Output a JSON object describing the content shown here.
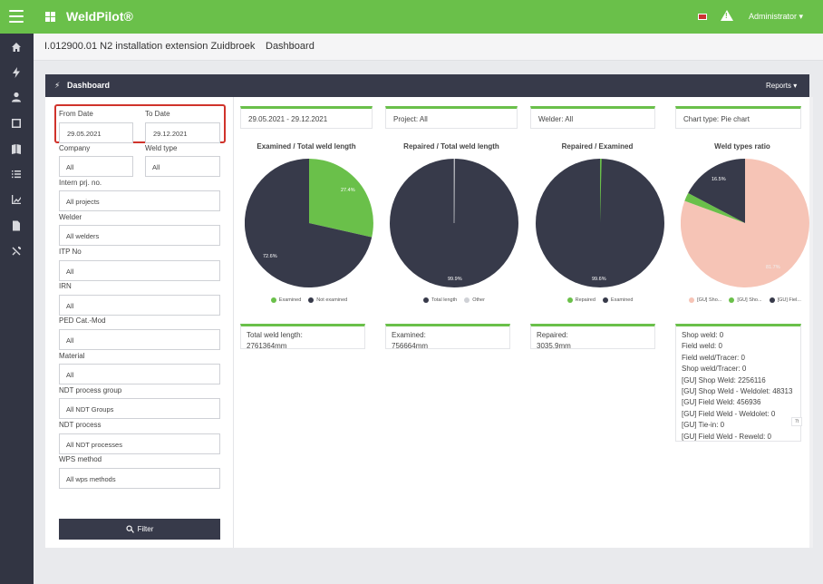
{
  "app": {
    "brand": "WeldPilot®",
    "user": "Administrator ▾"
  },
  "breadcrumb": {
    "project": "I.012900.01 N2 installation extension Zuidbroek",
    "page": "Dashboard",
    "separator": "/"
  },
  "panel": {
    "title": "Dashboard",
    "reports_label": "Reports ▾"
  },
  "filters": {
    "from_date_label": "From Date",
    "from_date_value": "29.05.2021",
    "to_date_label": "To Date",
    "to_date_value": "29.12.2021",
    "company_label": "Company",
    "company_value": "All",
    "weld_type_label": "Weld type",
    "weld_type_value": "All",
    "intern_label": "Intern prj. no.",
    "intern_value": "All projects",
    "welder_label": "Welder",
    "welder_value": "All welders",
    "itp_label": "ITP No",
    "itp_value": "All",
    "irn_label": "IRN",
    "irn_value": "All",
    "ped_label": "PED Cat.-Mod",
    "ped_value": "All",
    "material_label": "Material",
    "material_value": "All",
    "ndt_group_label": "NDT process group",
    "ndt_group_value": "All NDT Groups",
    "ndt_process_label": "NDT process",
    "ndt_process_value": "All NDT processes",
    "wps_label": "WPS method",
    "wps_value": "All wps methods",
    "filter_button": "Filter"
  },
  "summary": {
    "dates": "29.05.2021 - 29.12.2021",
    "project": "Project: All",
    "welder": "Welder: All",
    "chart_type": "Chart type: Pie chart"
  },
  "colors": {
    "green": "#6ac04a",
    "dark": "#373a4a",
    "peach": "#f6c4b6",
    "light": "#cfd1d6"
  },
  "charts": {
    "c1": {
      "title": "Examined / Total weld length",
      "legend": [
        "Examined",
        "Not examined"
      ],
      "labels": [
        "27.4%",
        "72.6%"
      ]
    },
    "c2": {
      "title": "Repaired / Total weld length",
      "legend": [
        "Total length",
        "Other"
      ],
      "labels": [
        "99.9%"
      ]
    },
    "c3": {
      "title": "Repaired / Examined",
      "legend": [
        "Repaired",
        "Examined"
      ],
      "labels": [
        "99.6%"
      ]
    },
    "c4": {
      "title": "Weld types ratio",
      "legend": [
        "[GU] Sho...",
        "[GU] Sho...",
        "[GU] Fiel..."
      ],
      "labels": [
        "16.5%",
        "81.7%"
      ]
    }
  },
  "chart_data": [
    {
      "type": "pie",
      "title": "Examined / Total weld length",
      "categories": [
        "Examined",
        "Not examined"
      ],
      "values": [
        27.4,
        72.6
      ]
    },
    {
      "type": "pie",
      "title": "Repaired / Total weld length",
      "categories": [
        "Total length",
        "Other"
      ],
      "values": [
        99.9,
        0.1
      ]
    },
    {
      "type": "pie",
      "title": "Repaired / Examined",
      "categories": [
        "Repaired",
        "Examined"
      ],
      "values": [
        0.4,
        99.6
      ]
    },
    {
      "type": "pie",
      "title": "Weld types ratio",
      "categories": [
        "[GU] Sho...",
        "[GU] Sho...",
        "[GU] Fiel..."
      ],
      "values": [
        81.7,
        1.8,
        16.5
      ]
    }
  ],
  "stats": {
    "total_label": "Total weld length:",
    "total_value": "2761364mm",
    "examined_label": "Examined:",
    "examined_value": "756664mm",
    "repaired_label": "Repaired:",
    "repaired_value": "3035.9mm",
    "types": [
      "Shop weld: 0",
      "Field weld: 0",
      "Field weld/Tracer: 0",
      "Shop weld/Tracer: 0",
      "[GU] Shop Weld: 2256116",
      "[GU] Shop Weld - Weldolet: 48313",
      "[GU] Field Weld: 456936",
      "[GU] Field Weld - Weldolet: 0",
      "[GU] Tie-in: 0",
      "[GU] Field Weld - Reweld: 0"
    ],
    "tag": "7t"
  }
}
